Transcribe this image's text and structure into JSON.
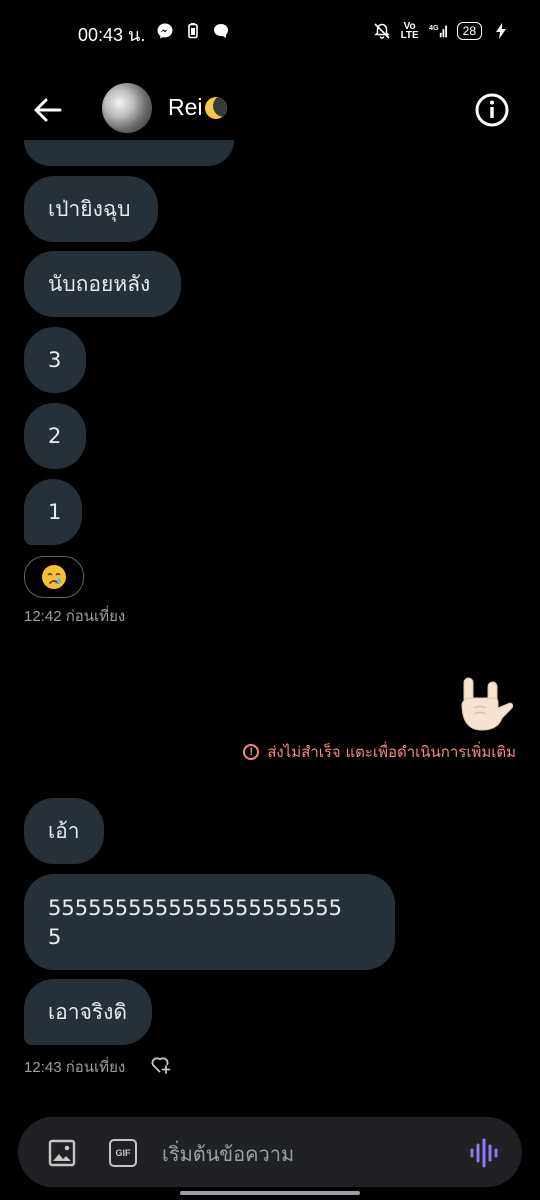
{
  "status_bar": {
    "time": "00:43 น.",
    "battery": "28"
  },
  "header": {
    "contact_name": "Rei",
    "moon_icon": "crescent-moon-emoji"
  },
  "messages": {
    "m1": "เป่ายิงฉุบ",
    "m2": "นับถอยหลัง",
    "m3": "3",
    "m4": "2",
    "m5": "1",
    "reaction_emoji": "😢",
    "time1": "12:42 ก่อนเที่ยง",
    "sent_emoji": "🤟🏻",
    "error_text": "ส่งไม่สำเร็จ แตะเพื่อดำเนินการเพิ่มเติม",
    "m6": "เอ้า",
    "m7_line1": "5555555555555555555555",
    "m7_line2": "5",
    "m8": "เอาจริงดิ",
    "time2": "12:43 ก่อนเที่ยง"
  },
  "compose": {
    "placeholder": "เริ่มต้นข้อความ",
    "gif_label": "GIF"
  },
  "colors": {
    "bubble": "#263039",
    "error": "#f28b82",
    "accent": "#8c7cf0"
  }
}
